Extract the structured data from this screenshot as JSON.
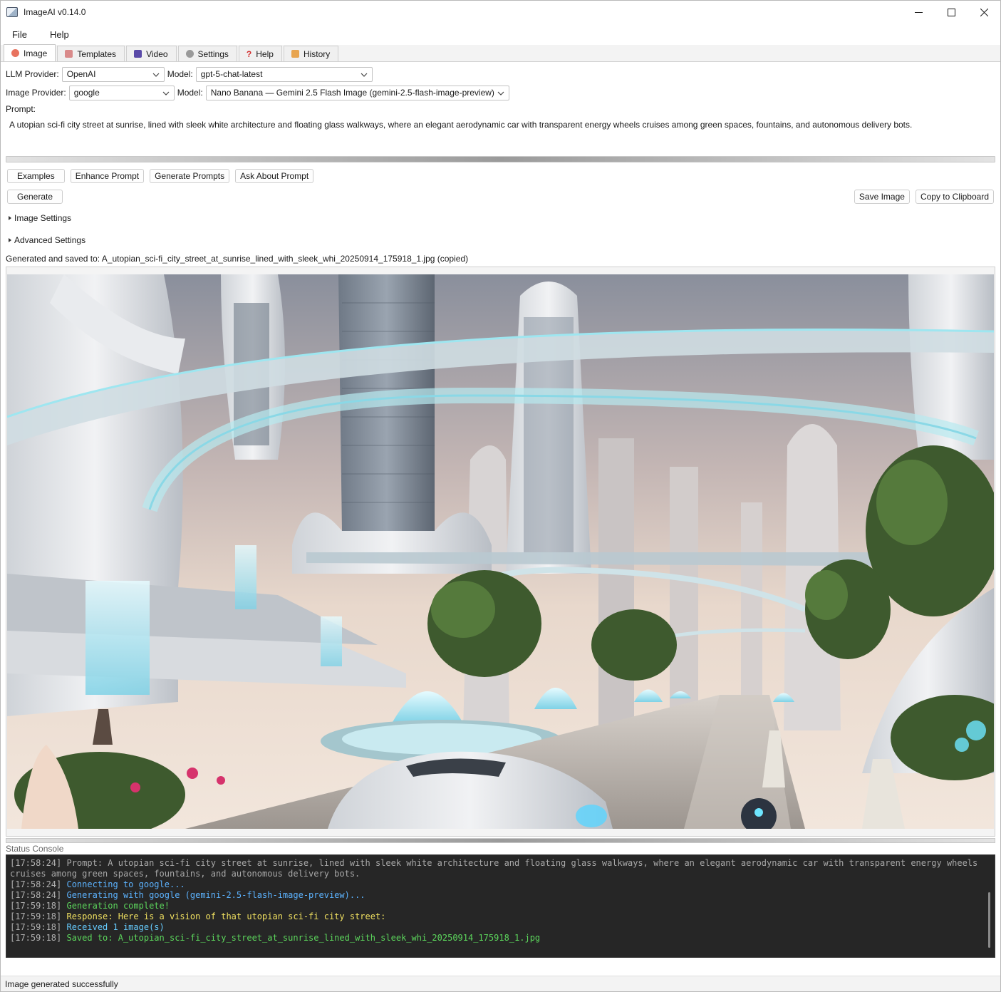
{
  "window": {
    "title": "ImageAI v0.14.0",
    "controls": {
      "minimize": "─",
      "maximize": "☐",
      "close": "✕"
    }
  },
  "menu": {
    "items": [
      "File",
      "Help"
    ]
  },
  "tabs": [
    {
      "label": "Image",
      "icon": "palette-icon",
      "color": "#e0533d",
      "active": true
    },
    {
      "label": "Templates",
      "icon": "templates-icon",
      "color": "#d97a7a",
      "active": false
    },
    {
      "label": "Video",
      "icon": "video-icon",
      "color": "#5a4aa8",
      "active": false
    },
    {
      "label": "Settings",
      "icon": "gear-icon",
      "color": "#888888",
      "active": false
    },
    {
      "label": "Help",
      "icon": "question-icon",
      "color": "#d32f2f",
      "active": false
    },
    {
      "label": "History",
      "icon": "scroll-icon",
      "color": "#e09a3c",
      "active": false
    }
  ],
  "llm": {
    "provider_label": "LLM Provider:",
    "provider_value": "OpenAI",
    "model_label": "Model:",
    "model_value": "gpt-5-chat-latest"
  },
  "image_provider": {
    "provider_label": "Image Provider:",
    "provider_value": "google",
    "model_label": "Model:",
    "model_value": "Nano Banana — Gemini 2.5 Flash Image (gemini-2.5-flash-image-preview)"
  },
  "prompt": {
    "label": "Prompt:",
    "value": "A utopian sci-fi city street at sunrise, lined with sleek white architecture and floating glass walkways, where an elegant aerodynamic car with transparent energy wheels cruises among green spaces, fountains, and autonomous delivery bots."
  },
  "buttons": {
    "examples": "Examples",
    "enhance_prompt": "Enhance Prompt",
    "generate_prompts": "Generate Prompts",
    "ask_about_prompt": "Ask About Prompt",
    "generate": "Generate",
    "save_image": "Save Image",
    "copy_to_clipboard": "Copy to Clipboard"
  },
  "sections": {
    "image_settings": "Image Settings",
    "advanced_settings": "Advanced Settings"
  },
  "saved_message": "Generated and saved to: A_utopian_sci-fi_city_street_at_sunrise_lined_with_sleek_whi_20250914_175918_1.jpg (copied)",
  "console": {
    "label": "Status Console",
    "lines": [
      {
        "ts": "[17:58:24]",
        "text": "Prompt: A utopian sci-fi city street at sunrise, lined with sleek white architecture and floating glass walkways, where an elegant aerodynamic car with transparent energy wheels cruises among green spaces, fountains, and autonomous delivery bots.",
        "color": "#a8a8a8"
      },
      {
        "ts": "[17:58:24]",
        "text": "Connecting to google...",
        "color": "#5cb3ff"
      },
      {
        "ts": "[17:58:24]",
        "text": "Generating with google (gemini-2.5-flash-image-preview)...",
        "color": "#5cb3ff"
      },
      {
        "ts": "[17:59:18]",
        "text": "Generation complete!",
        "color": "#5cd65c"
      },
      {
        "ts": "[17:59:18]",
        "text": "Response: Here is a vision of that utopian sci-fi city street:",
        "color": "#f0e060"
      },
      {
        "ts": "[17:59:18]",
        "text": "Received 1 image(s)",
        "color": "#66ccff"
      },
      {
        "ts": "[17:59:18]",
        "text": "Saved to: A_utopian_sci-fi_city_street_at_sunrise_lined_with_sleek_whi_20250914_175918_1.jpg",
        "color": "#5cd65c"
      }
    ]
  },
  "status_bar": "Image generated successfully"
}
